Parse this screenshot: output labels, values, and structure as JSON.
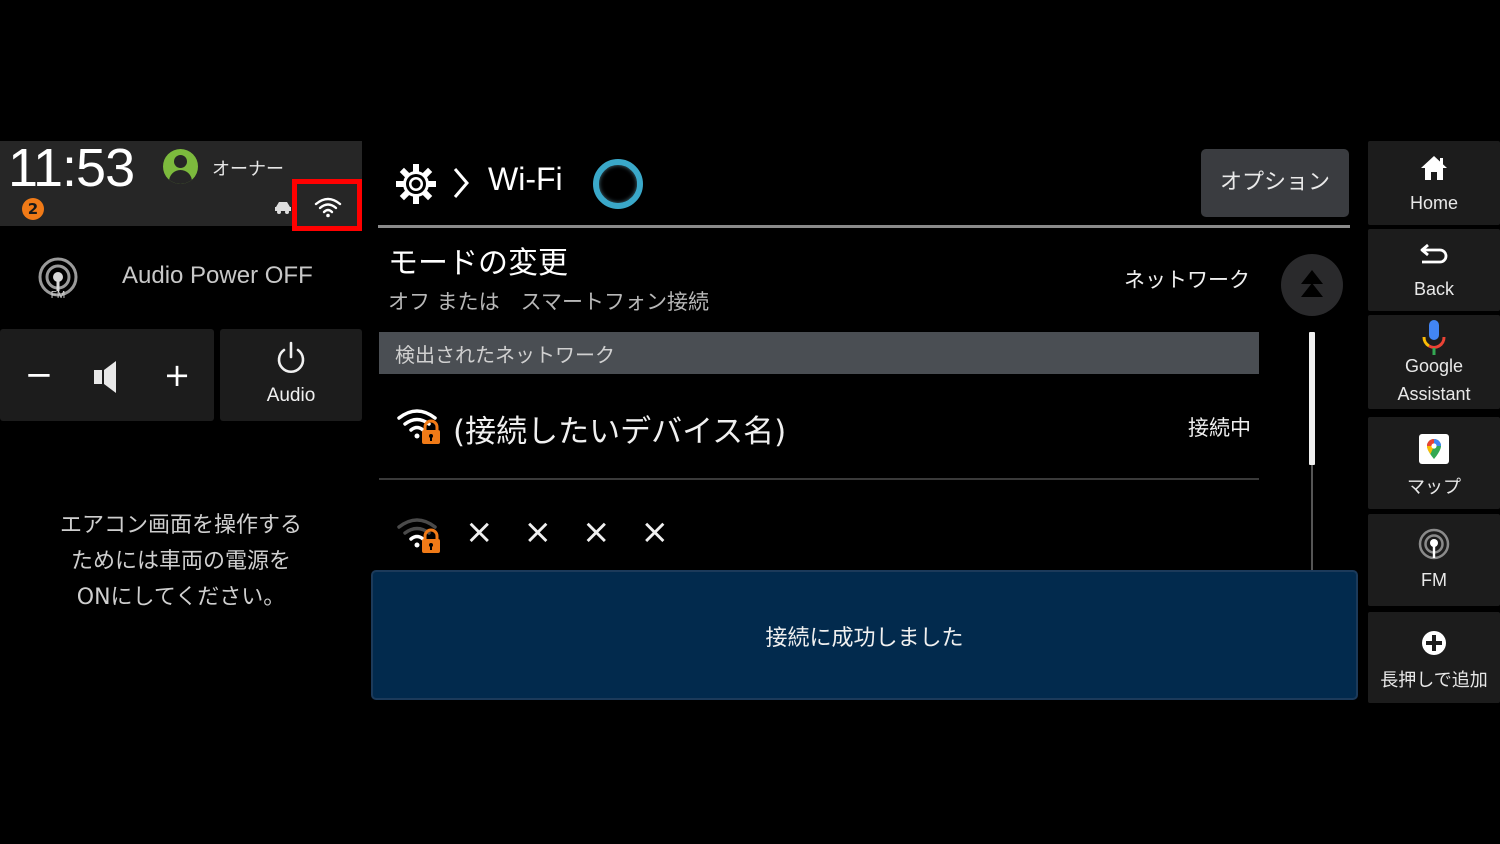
{
  "status_bar": {
    "time": "11:53",
    "user_name": "オーナー",
    "notification_count": "2",
    "icons": [
      "user-icon",
      "car-icon",
      "wifi-icon"
    ]
  },
  "audio": {
    "source_icon": "fm-radio-icon",
    "source_icon_label": "FM",
    "power_status": "Audio Power OFF",
    "volume_down_label": "−",
    "volume_up_label": "+",
    "audio_button_label": "Audio"
  },
  "climate": {
    "message_lines": [
      "エアコン画面を操作する",
      "ためには車両の電源を",
      "ONにしてください。"
    ]
  },
  "header": {
    "breadcrumb_icon": "gear-icon",
    "breadcrumb_separator": "chevron-right-icon",
    "title": "Wi-Fi",
    "option_button": "オプション"
  },
  "mode": {
    "title": "モードの変更",
    "subtitle": "オフ または　スマートフォン接続",
    "value": "ネットワーク"
  },
  "networks": {
    "section_title": "検出されたネットワーク",
    "items": [
      {
        "name": "(接続したいデバイス名)",
        "status": "接続中",
        "icon": "wifi-lock-icon",
        "signal": "full"
      },
      {
        "name": "××××",
        "status": "",
        "icon": "wifi-lock-icon",
        "signal": "weak"
      }
    ]
  },
  "toast": {
    "message": "接続に成功しました"
  },
  "dock": {
    "items": [
      {
        "label": "Home",
        "icon": "home-icon"
      },
      {
        "label": "Back",
        "icon": "back-icon"
      },
      {
        "label_line1": "Google",
        "label_line2": "Assistant",
        "icon": "microphone-icon"
      },
      {
        "label": "マップ",
        "icon": "maps-icon"
      },
      {
        "label": "FM",
        "icon": "fm-radio-icon"
      },
      {
        "label": "長押しで追加",
        "icon": "add-icon"
      }
    ]
  },
  "colors": {
    "accent_ring": "#3aa8c9",
    "user_avatar": "#7cba3d",
    "badge": "#f07a17",
    "lock": "#f07a17",
    "toast_bg": "#022a4d",
    "highlight": "#ff0000"
  }
}
